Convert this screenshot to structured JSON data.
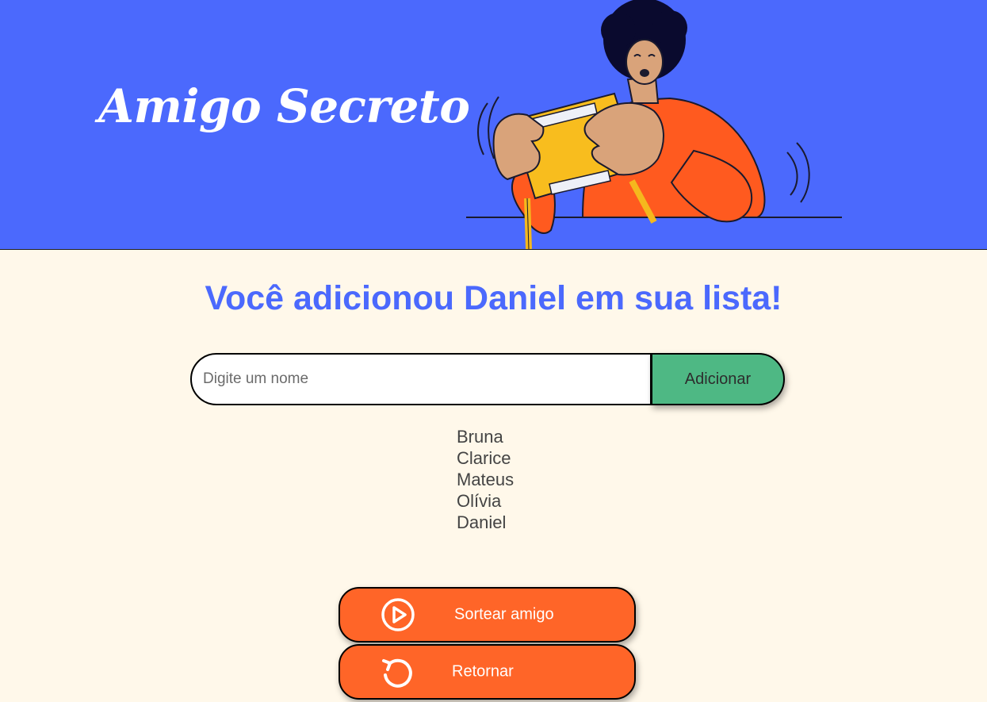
{
  "header": {
    "title": "Amigo Secreto",
    "background_color": "#4b69fd"
  },
  "main": {
    "heading": "Você adicionou Daniel em sua lista!",
    "heading_color": "#4b69fd",
    "background_color": "#fff8ea"
  },
  "form": {
    "input_placeholder": "Digite um nome",
    "input_value": "",
    "add_button_label": "Adicionar",
    "add_button_color": "#4eb884"
  },
  "friends": [
    "Bruna",
    "Clarice",
    "Mateus",
    "Olívia",
    "Daniel"
  ],
  "actions": {
    "draw_label": "Sortear amigo",
    "draw_icon": "play-circle-icon",
    "return_label": "Retornar",
    "return_icon": "refresh-icon",
    "button_color": "#ff6528"
  }
}
